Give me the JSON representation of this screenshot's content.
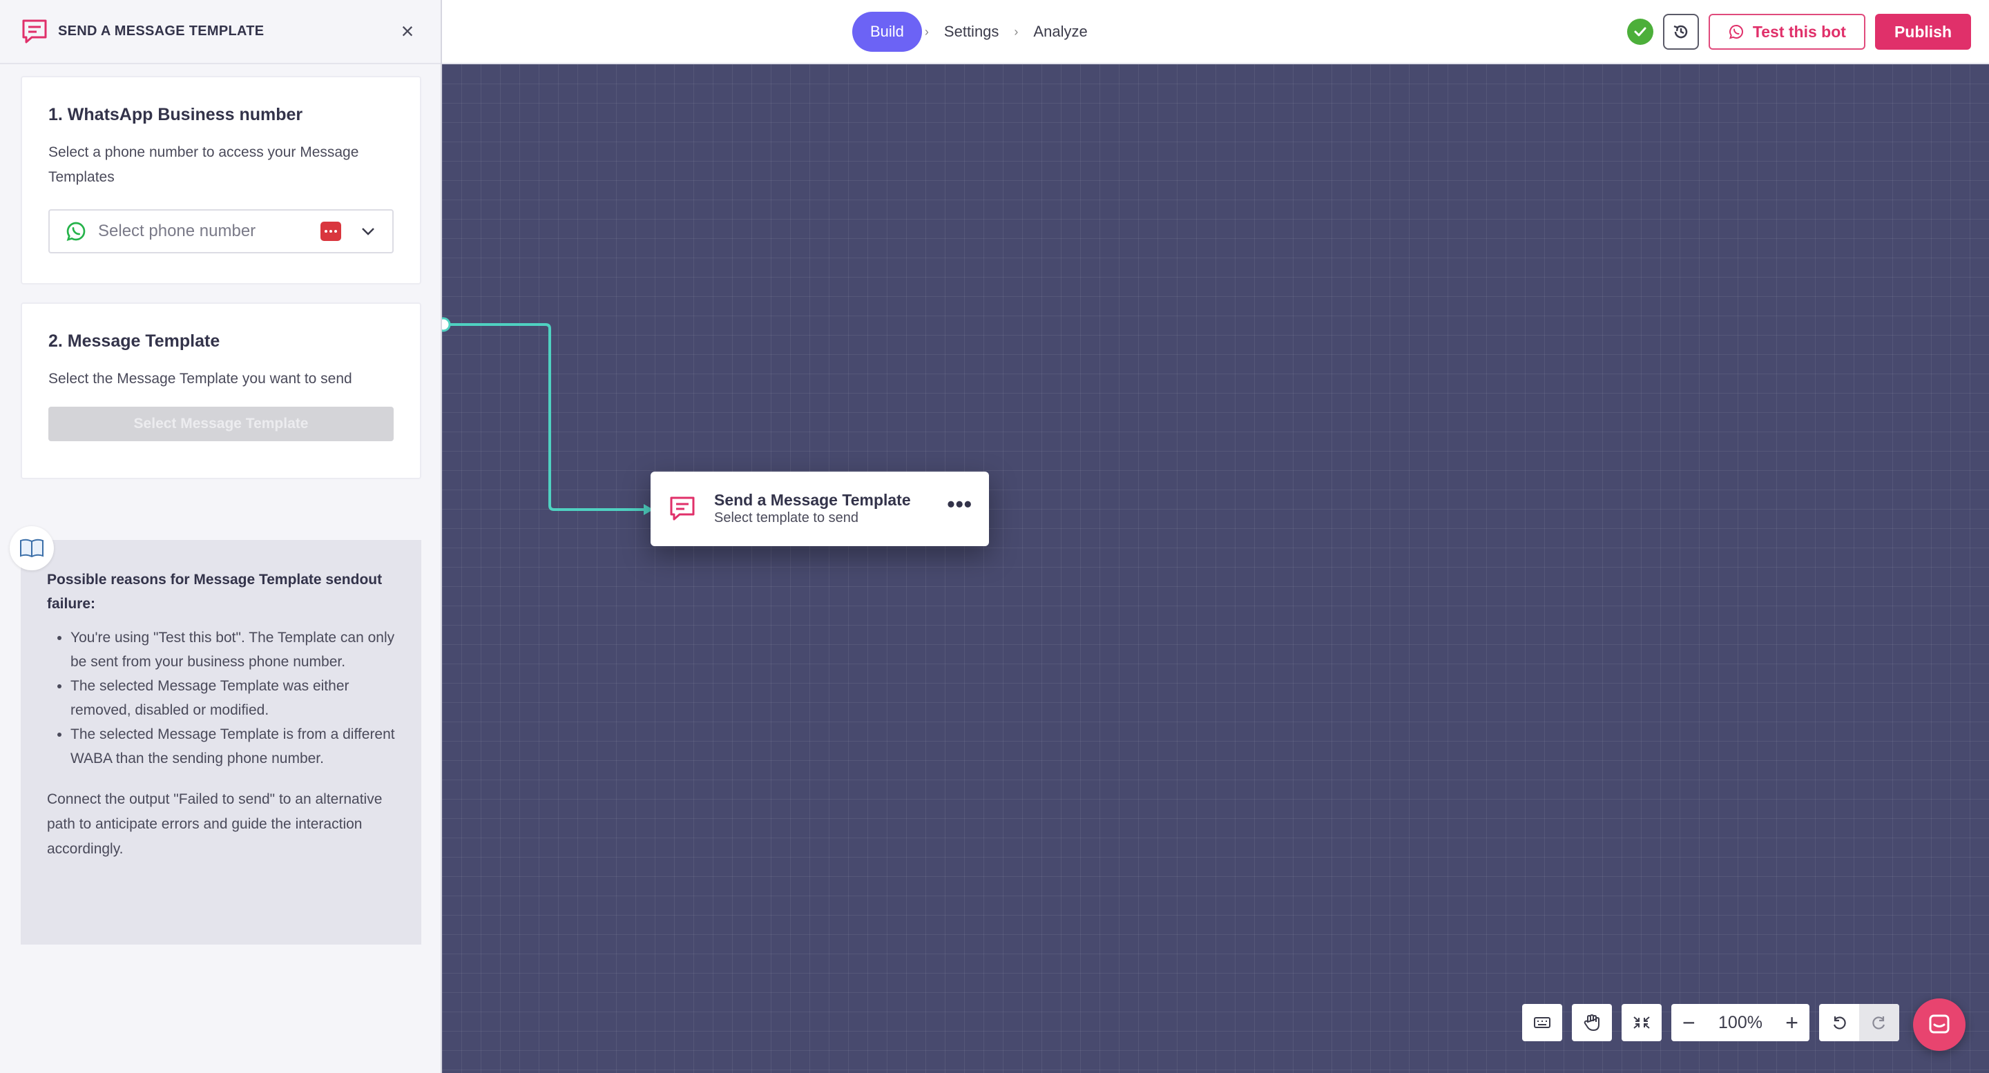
{
  "sidebar": {
    "title": "SEND A MESSAGE TEMPLATE",
    "section1": {
      "heading": "1. WhatsApp Business number",
      "description": "Select a phone number to access your Message Templates",
      "phone_placeholder": "Select phone number"
    },
    "section2": {
      "heading": "2. Message Template",
      "description": "Select the Message Template you want to send",
      "button_label": "Select Message Template"
    },
    "info": {
      "title": "Possible reasons for Message Template sendout failure:",
      "reasons": [
        "You're using \"Test this bot\". The Template can only be sent from your business phone number.",
        "The selected Message Template was either removed, disabled or modified.",
        "The selected Message Template is from a different WABA than the sending phone number."
      ],
      "footer": "Connect the output \"Failed to send\" to an alternative path to anticipate errors and guide the interaction accordingly."
    }
  },
  "nav": {
    "steps": [
      "Build",
      "Settings",
      "Analyze"
    ],
    "active_step": "Build",
    "test_label": "Test this bot",
    "publish_label": "Publish"
  },
  "node": {
    "title": "Send a Message Template",
    "subtitle": "Select template to send"
  },
  "controls": {
    "zoom": "100%"
  },
  "colors": {
    "accent": "#6c63f5",
    "brand": "#e0306a",
    "canvas": "#484a6e",
    "connector": "#4fd1c1",
    "ok": "#4caf3a"
  }
}
